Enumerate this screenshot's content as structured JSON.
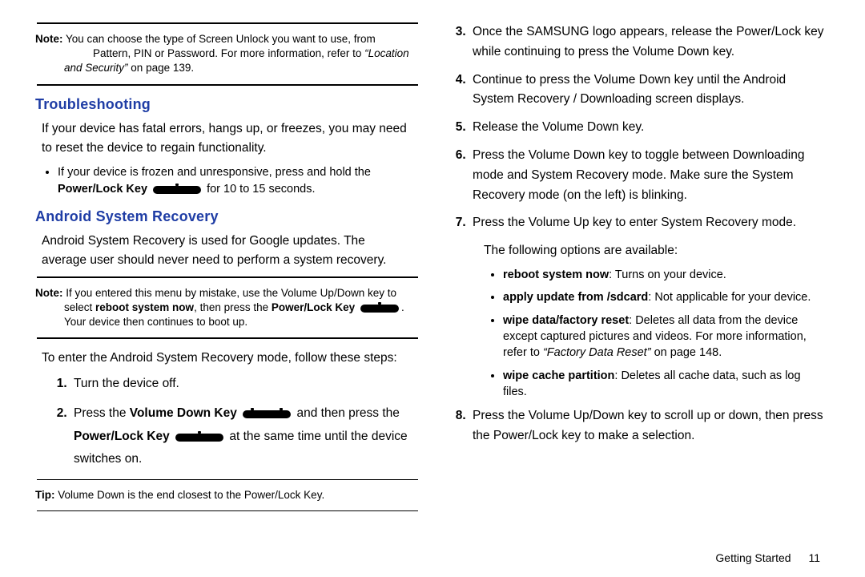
{
  "footer": {
    "section": "Getting Started",
    "page": "11"
  },
  "note1": {
    "label": "Note:",
    "l1": "You can choose the type of Screen Unlock you want to use, from",
    "l2": "Pattern, PIN or Password. For more information, refer to ",
    "ref": "“Location and Security”",
    "l3": " on page 139."
  },
  "secTroubleshooting": "Troubleshooting",
  "troubleP": "If your device has fatal errors, hangs up, or freezes, you may need to reset the device to regain functionality.",
  "troubleBullet": {
    "pre": "If your device is frozen and unresponsive, press and hold the ",
    "bold1": "Power/Lock Key",
    "post": " for 10 to 15 seconds."
  },
  "secASR": "Android System Recovery",
  "asrP": "Android System Recovery is used for Google updates. The average user should never need to perform a system recovery.",
  "note2": {
    "label": "Note:",
    "l1": "If you entered this menu by mistake, use the Volume Up/Down key to select ",
    "b1": "reboot system now",
    "l2": ", then press the ",
    "b2": "Power/Lock Key",
    "l3": ". Your device then continues to boot up."
  },
  "enterIntro": "To enter the Android System Recovery mode, follow these steps:",
  "step1": "Turn the device off.",
  "step2": {
    "a": "Press the ",
    "k1": "Volume Down Key",
    "b": " and then press the ",
    "k2": "Power/Lock Key",
    "c": " at the same time until the device switches on."
  },
  "tip": {
    "label": "Tip:",
    "text": "Volume Down is the end closest to the Power/Lock Key."
  },
  "step3": "Once the SAMSUNG logo appears, release the Power/Lock key while continuing to press the Volume Down key.",
  "step4": "Continue to press the Volume Down key until the Android System Recovery / Downloading screen displays.",
  "step5": "Release the Volume Down key.",
  "step6": "Press the Volume Down key to toggle between Downloading mode and System Recovery mode. Make sure the System Recovery mode (on the left) is blinking.",
  "step7": "Press the Volume Up key to enter System Recovery mode.",
  "optionsIntro": "The following options are available:",
  "optA": {
    "b": "reboot system now",
    "t": ": Turns on your device."
  },
  "optB": {
    "b": "apply update from /sdcard",
    "t": ": Not applicable for your device."
  },
  "optC": {
    "b": "wipe data/factory reset",
    "t1": ": Deletes all data from the device except captured pictures and videos. For more information, refer to ",
    "ref": "“Factory Data Reset”",
    "t2": " on page 148."
  },
  "optD": {
    "b": "wipe cache partition",
    "t": ": Deletes all cache data, such as log files."
  },
  "step8": "Press the Volume Up/Down key to scroll up or down, then press the Power/Lock key to make a selection."
}
